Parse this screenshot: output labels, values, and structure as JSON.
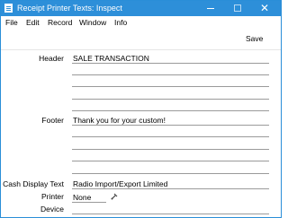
{
  "window": {
    "title": "Receipt Printer Texts: Inspect"
  },
  "menu": {
    "items": [
      "File",
      "Edit",
      "Record",
      "Window",
      "Info"
    ]
  },
  "toolbar": {
    "save_label": "Save"
  },
  "form": {
    "header_label": "Header",
    "header_value": "SALE TRANSACTION",
    "footer_label": "Footer",
    "footer_value": "Thank you for your custom!",
    "cash_display_label": "Cash Display Text",
    "cash_display_value": "Radio Import/Export Limited",
    "printer_label": "Printer",
    "printer_value": "None",
    "device_label": "Device",
    "device_value": ""
  },
  "colors": {
    "titlebar": "#2d8fd9",
    "field_line": "#9a9a9a",
    "background": "#ffffff"
  },
  "icons": [
    "app-icon",
    "minimize-icon",
    "maximize-icon",
    "close-icon",
    "paste-icon"
  ]
}
